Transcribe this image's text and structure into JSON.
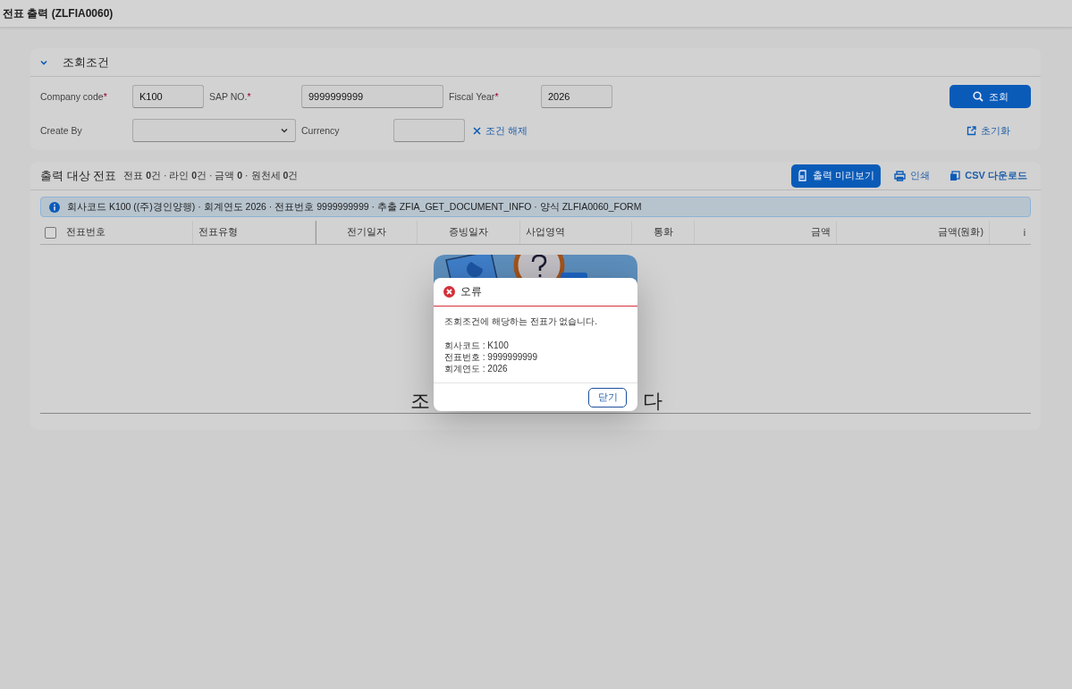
{
  "page_title": "전표 출력 (ZLFIA0060)",
  "filter_panel": {
    "title": "조회조건",
    "expanded": true,
    "required_mark": "*",
    "company_code": {
      "label": "Company code",
      "required": true,
      "value": "K100"
    },
    "sap_no": {
      "label": "SAP NO.",
      "required": true,
      "value": "9999999999"
    },
    "fiscal_year": {
      "label": "Fiscal Year",
      "required": true,
      "value": "2026"
    },
    "create_by": {
      "label": "Create By",
      "required": false
    },
    "currency": {
      "label": "Currency",
      "required": false
    },
    "clear_link": "조건 해제",
    "search_button": "조회",
    "reset_link": "초기화"
  },
  "result_panel": {
    "title": "출력 대상 전표",
    "summary": "전표 **0**건 · 라인 **0**건 · 금액 **0** · 원천세 **0**건",
    "actions": [
      {
        "label": "출력 미리보기",
        "kind": "primary"
      },
      {
        "label": "인쇄",
        "kind": "print"
      },
      {
        "label": "CSV 다운로드",
        "kind": "csv"
      }
    ],
    "info_message": "회사코드 K100 ((주)경인양행) · 회계연도 2026 · 전표번호 9999999999 · 추출 ZFIA_GET_DOCUMENT_INFO · 양식 ZLFIA0060_FORM",
    "select_all_checked": false,
    "columns": [
      "전표번호",
      "전표유형",
      "전기일자",
      "증빙일자",
      "사업영역",
      "통화",
      "금액",
      "금액(원화)",
      "i"
    ],
    "empty_text_start": "조",
    "empty_text_end": "다"
  },
  "dialog": {
    "title": "오류",
    "is_error": true,
    "message": "조회조건에 해당하는 전표가 없습니다.",
    "details": [
      "회사코드 : K100",
      "전표번호 : 9999999999",
      "회계연도 : 2026"
    ],
    "close_button": "닫기"
  }
}
